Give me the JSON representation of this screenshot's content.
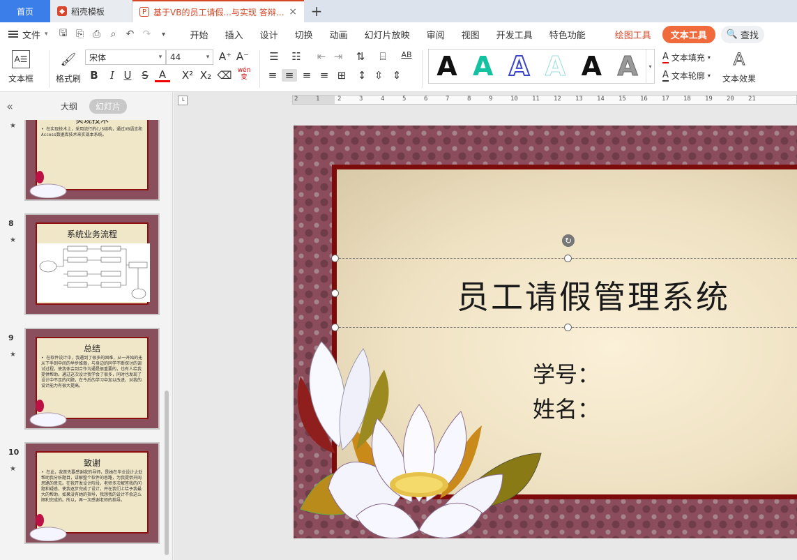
{
  "tabs": {
    "home": "首页",
    "docer": "稻壳模板",
    "active": "基于VB的员工请假...与实现 答辩PPT",
    "close_glyph": "×",
    "add_glyph": "+"
  },
  "menu": {
    "file": "文件",
    "items": [
      "开始",
      "插入",
      "设计",
      "切换",
      "动画",
      "幻灯片放映",
      "审阅",
      "视图",
      "开发工具",
      "特色功能"
    ],
    "drawing_tools": "绘图工具",
    "text_tools": "文本工具",
    "search": "查找"
  },
  "ribbon": {
    "textbox": "文本框",
    "format_painter": "格式刷",
    "font_name": "宋体",
    "font_size": "44",
    "bold": "B",
    "italic": "I",
    "underline": "U",
    "strike": "S",
    "font_color": "A",
    "superscript": "X²",
    "subscript": "X₂",
    "phonetic": "wén 变",
    "gallery_letter": "A",
    "text_fill": "文本填充",
    "text_outline": "文本轮廓",
    "text_effect": "文本效果"
  },
  "left_panel": {
    "outline_tab": "大纲",
    "slides_tab": "幻灯片",
    "slides": [
      {
        "num": "",
        "title": "实现技术",
        "body": "• 在实现技术上，采用流行的C/S结构，通过VB语言和Access数据库技术来实现本系统。"
      },
      {
        "num": "8",
        "title": "系统业务流程",
        "body": ""
      },
      {
        "num": "9",
        "title": "总结",
        "body": "• 在软件设计中，我遇到了很多的困难，从一开始的无从下手到中间的举步维艰，与身边的同学不断探讨的调试过程，使我体会到合作沟通是很重要的，也有人给我提供帮助。通过这次设计我学会了很多，同时也发现了设计中不足的问题，在今后的学习中加以改进，对我的设计能力有很大提高。"
      },
      {
        "num": "10",
        "title": "致谢",
        "body": "• 在此，我首先要感谢我的导师，是她在毕业设计之处帮助我分析题目，讲解整个软件的思路，为我提供开阔思路的意见。在我开发设计阶段，老师多次解答我的问题和疑惑，使我逐步完成了设计，并在我们上给予我最大的帮助，如果没有她的指导，我想我的设计不会这么顺利完成的。所以，再一次感谢老师的指导。"
      }
    ]
  },
  "slide": {
    "title": "员工请假管理系统",
    "line1": "学号：",
    "line2": "姓名："
  },
  "ruler": [
    "2",
    "1",
    "2",
    "3",
    "4",
    "5",
    "6",
    "7",
    "8",
    "9",
    "10",
    "11",
    "12",
    "13",
    "14",
    "15",
    "16",
    "17",
    "18",
    "19",
    "20",
    "21"
  ],
  "colors": {
    "accent": "#d24726",
    "home_tab": "#3b7de9",
    "pill": "#f06a3b",
    "slide_bg": "#8b4d5b",
    "frame": "#7d0b0b"
  }
}
